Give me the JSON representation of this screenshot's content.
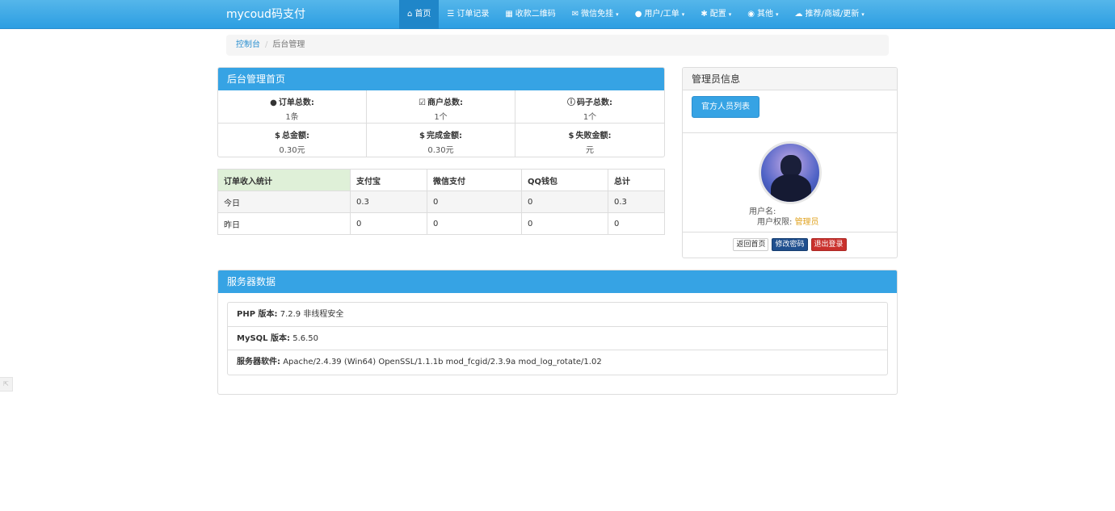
{
  "navbar": {
    "brand": "mycoud码支付",
    "items": [
      {
        "label": "首页",
        "icon": "home-icon",
        "glyph": "⌂",
        "active": true,
        "dropdown": false
      },
      {
        "label": "订单记录",
        "icon": "list-icon",
        "glyph": "☰",
        "dropdown": false
      },
      {
        "label": "收款二维码",
        "icon": "qrcode-icon",
        "glyph": "▦",
        "dropdown": false
      },
      {
        "label": "微信免挂",
        "icon": "wechat-icon",
        "glyph": "✉",
        "dropdown": true
      },
      {
        "label": "用户/工单",
        "icon": "user-icon",
        "glyph": "●",
        "dropdown": true
      },
      {
        "label": "配置",
        "icon": "gear-icon",
        "glyph": "✱",
        "dropdown": true
      },
      {
        "label": "其他",
        "icon": "globe-icon",
        "glyph": "◉",
        "dropdown": true
      },
      {
        "label": "推荐/商城/更新",
        "icon": "cloud-icon",
        "glyph": "☁",
        "dropdown": true
      }
    ],
    "caret": "▾"
  },
  "breadcrumb": {
    "home": "控制台",
    "separator": "/",
    "current": "后台管理"
  },
  "stats_panel": {
    "title": "后台管理首页",
    "items": [
      {
        "label": "订单总数:",
        "value": "1条",
        "icon": "drop-icon",
        "glyph": "●"
      },
      {
        "label": "商户总数:",
        "value": "1个",
        "icon": "check-square-icon",
        "glyph": "☑"
      },
      {
        "label": "码子总数:",
        "value": "1个",
        "icon": "info-circle-icon",
        "glyph": "ⓘ"
      },
      {
        "label": "总金额:",
        "value": "0.30元",
        "icon": "dollar-icon",
        "glyph": "$"
      },
      {
        "label": "完成金额:",
        "value": "0.30元",
        "icon": "dollar-icon",
        "glyph": "$"
      },
      {
        "label": "失败金额:",
        "value": "元",
        "icon": "dollar-icon",
        "glyph": "$"
      }
    ]
  },
  "income_table": {
    "headers": [
      "订单收入统计",
      "支付宝",
      "微信支付",
      "QQ钱包",
      "总计"
    ],
    "rows": [
      [
        "今日",
        "0.3",
        "0",
        "0",
        "0.3"
      ],
      [
        "昨日",
        "0",
        "0",
        "0",
        "0"
      ]
    ]
  },
  "admin_panel": {
    "title": "管理员信息",
    "staff_button": "官方人员列表",
    "username_label": "用户名:",
    "username_value": "",
    "role_label": "用户权限:",
    "role_value": "管理员",
    "actions": {
      "home": "返回首页",
      "change_password": "修改密码",
      "logout": "退出登录"
    }
  },
  "server_panel": {
    "title": "服务器数据",
    "items": [
      {
        "label": "PHP 版本:",
        "value": "7.2.9 非线程安全"
      },
      {
        "label": "MySQL 版本:",
        "value": "5.6.50"
      },
      {
        "label": "服务器软件:",
        "value": "Apache/2.4.39 (Win64) OpenSSL/1.1.1b mod_fcgid/2.3.9a mod_log_rotate/1.02"
      }
    ]
  },
  "colors": {
    "accent": "#36a3e4",
    "success_bg": "#dff0d8",
    "gold": "#e0a321",
    "danger": "#c9302c",
    "primary_dark": "#1f4f8e"
  }
}
